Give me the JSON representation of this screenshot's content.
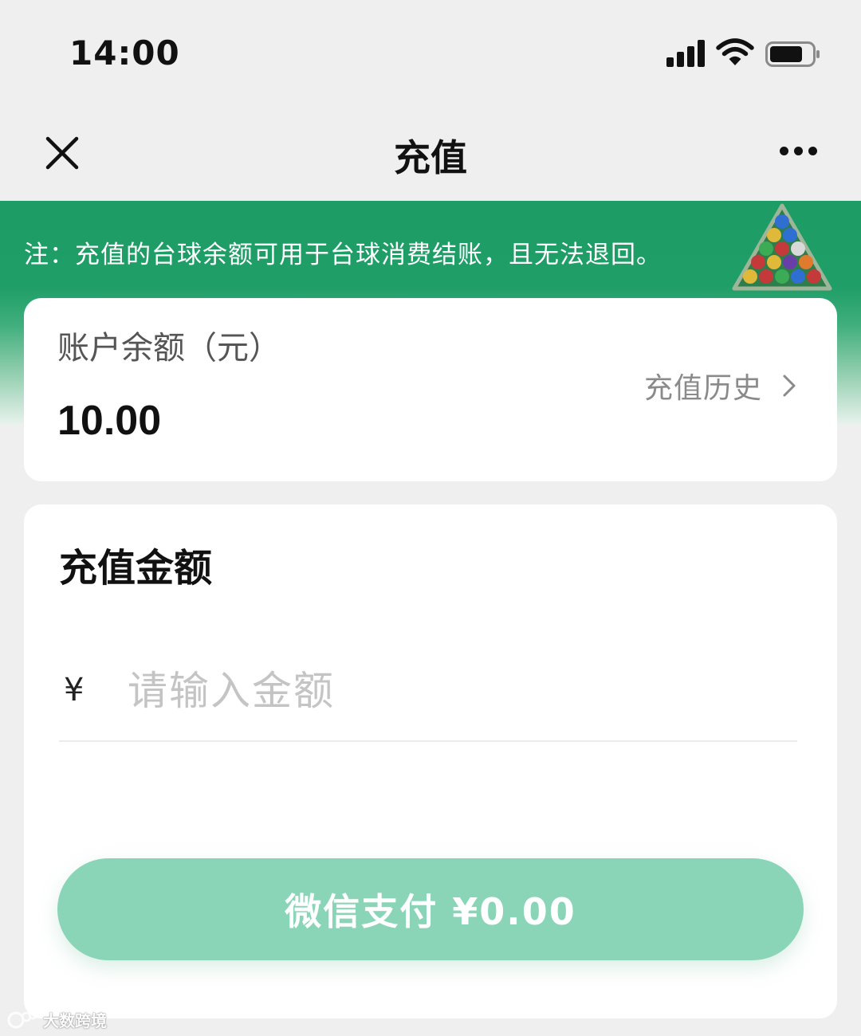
{
  "status_bar": {
    "time": "14:00",
    "icons": [
      "cellular-signal-icon",
      "wifi-icon",
      "battery-icon"
    ]
  },
  "nav": {
    "title": "充值",
    "close_icon": "close-icon",
    "more_icon": "more-icon"
  },
  "banner": {
    "notice": "注：充值的台球余额可用于台球消费结账，且无法退回。",
    "image": "billiard-balls-rack-icon"
  },
  "balance": {
    "label": "账户余额（元）",
    "value": "10.00",
    "history_label": "充值历史"
  },
  "recharge": {
    "title": "充值金额",
    "currency": "¥",
    "placeholder": "请输入金额",
    "value": ""
  },
  "pay_button": {
    "label": "微信支付  ¥0.00"
  },
  "watermark": {
    "text": "大数跨境"
  },
  "colors": {
    "brand_green": "#1e9c66",
    "pay_button": "#8ad5b7",
    "background": "#efefef"
  }
}
